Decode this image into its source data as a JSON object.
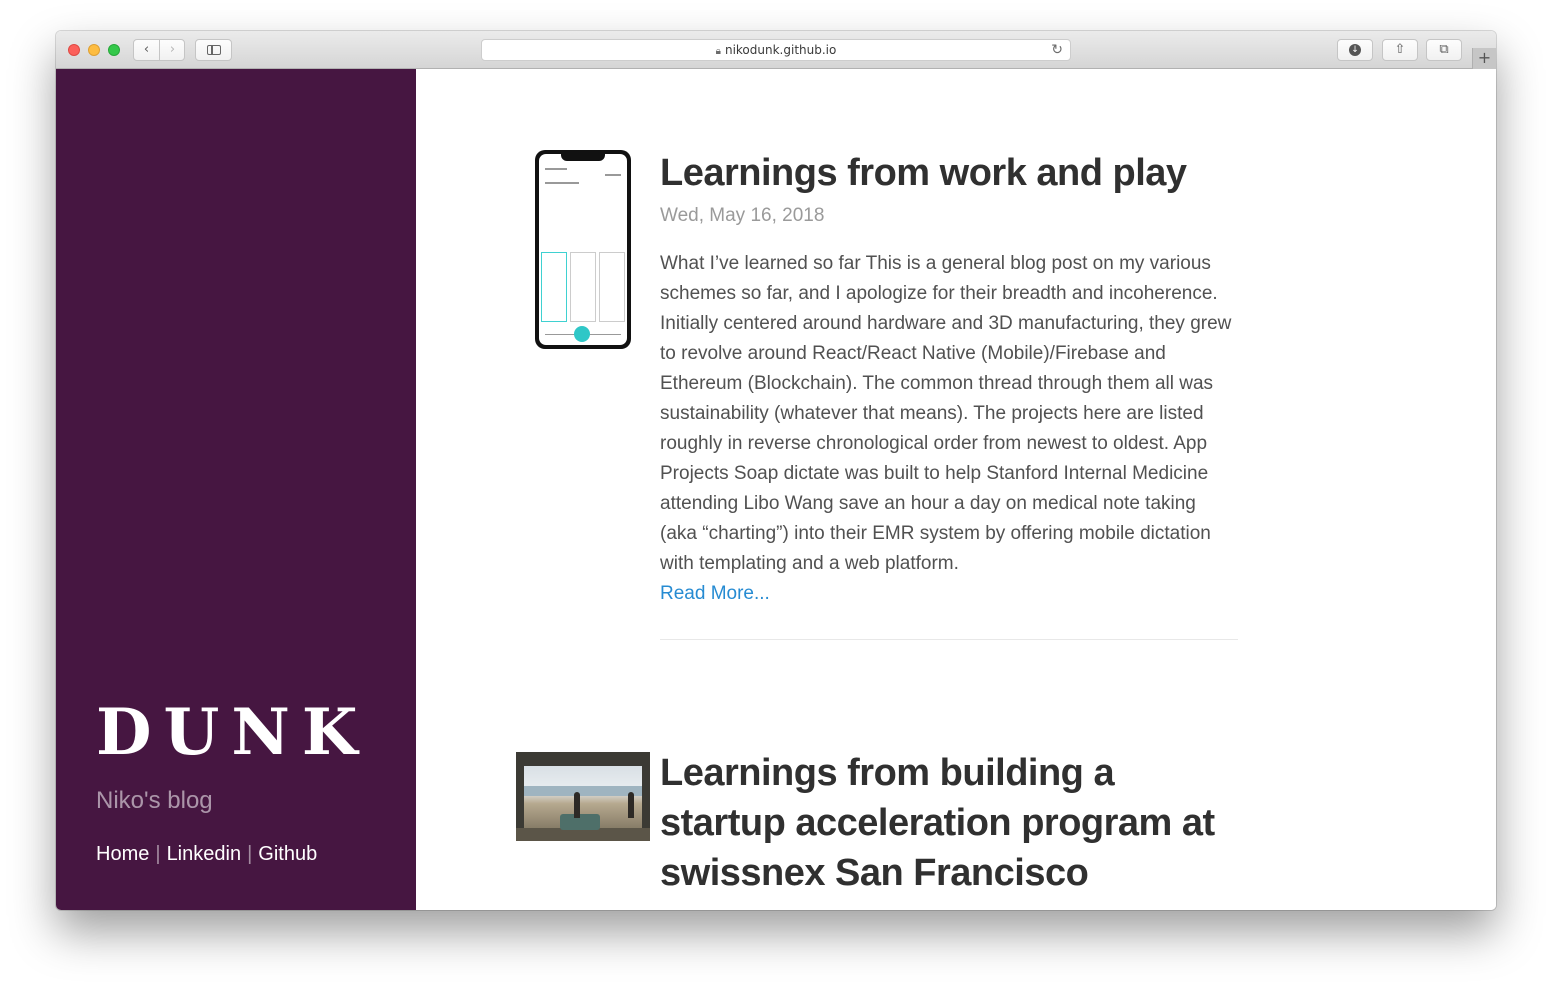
{
  "browser": {
    "url": "nikodunk.github.io",
    "nav_back_label": "‹",
    "nav_forward_label": "›",
    "new_tab_label": "+"
  },
  "sidebar": {
    "title": "DUNK",
    "description": "Niko's blog",
    "nav": [
      {
        "label": "Home"
      },
      {
        "label": "Linkedin"
      },
      {
        "label": "Github"
      }
    ],
    "separator": "|",
    "background_color": "#461641"
  },
  "posts": [
    {
      "title": "Learnings from work and play",
      "date": "Wed, May 16, 2018",
      "excerpt": "What I’ve learned so far This is a general blog post on my various schemes so far, and I apologize for their breadth and incoherence. Initially centered around hardware and 3D manufacturing, they grew to revolve around React/React Native (Mobile)/Firebase and Ethereum (Blockchain). The common thread through them all was sustainability (whatever that means). The projects here are listed roughly in reverse chronological order from newest to oldest. App Projects Soap dictate was built to help Stanford Internal Medicine attending Libo Wang save an hour a day on medical note taking (aka “charting”) into their EMR system by offering mobile dictation with templating and a web platform.",
      "read_more": "Read More...",
      "thumbnail": "phone-app-screenshot"
    },
    {
      "title": "Learnings from building a startup acceleration program at swissnex San Francisco",
      "thumbnail": "office-photo"
    }
  ],
  "colors": {
    "link": "#268bd2",
    "title": "#303030",
    "date": "#9a9a9a"
  }
}
